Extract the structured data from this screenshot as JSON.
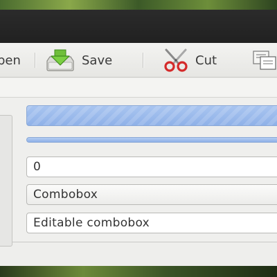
{
  "toolbar": {
    "open_label_partial": "pen",
    "save_label": "Save",
    "cut_label": "Cut"
  },
  "icons": {
    "save": "save-icon",
    "cut": "scissors-icon",
    "copy": "copy-icon"
  },
  "progress": {
    "main_fraction": 1.0,
    "thin_fraction": 1.0
  },
  "form": {
    "spin_value": "0",
    "combobox_value": "Combobox",
    "editable_combobox_value": "Editable combobox"
  },
  "colors": {
    "accent": "#8fb1e8",
    "titlebar": "#252525",
    "cut_red": "#d42a2a"
  }
}
